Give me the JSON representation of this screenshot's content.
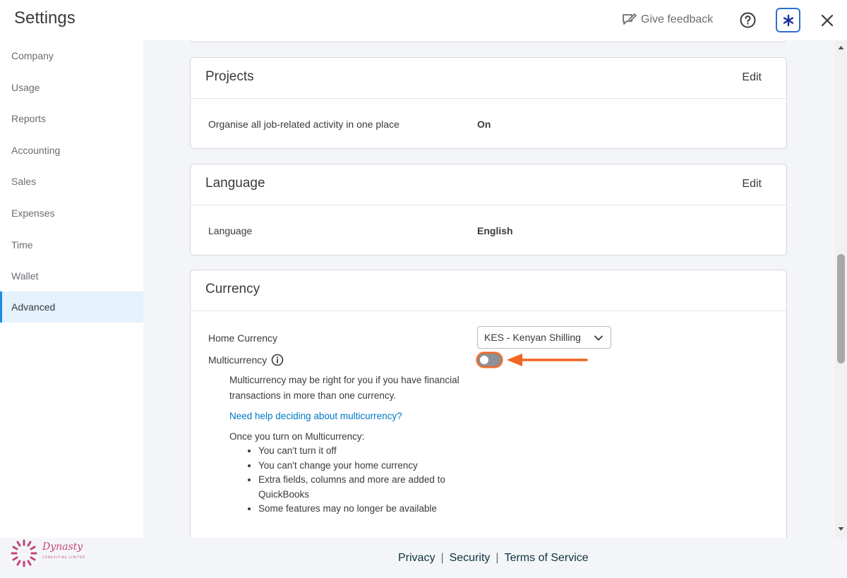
{
  "header": {
    "title": "Settings",
    "feedback_label": "Give feedback"
  },
  "sidebar": {
    "items": [
      {
        "label": "Company"
      },
      {
        "label": "Usage"
      },
      {
        "label": "Reports"
      },
      {
        "label": "Accounting"
      },
      {
        "label": "Sales"
      },
      {
        "label": "Expenses"
      },
      {
        "label": "Time"
      },
      {
        "label": "Wallet"
      },
      {
        "label": "Advanced",
        "active": true
      }
    ]
  },
  "projects": {
    "title": "Projects",
    "edit_label": "Edit",
    "row_label": "Organise all job-related activity in one place",
    "row_value": "On"
  },
  "language": {
    "title": "Language",
    "edit_label": "Edit",
    "row_label": "Language",
    "row_value": "English"
  },
  "currency": {
    "title": "Currency",
    "home_currency_label": "Home Currency",
    "home_currency_value": "KES - Kenyan Shilling",
    "multicurrency_label": "Multicurrency",
    "multicurrency_on": false,
    "desc_line1": "Multicurrency may be right for you if you have financial",
    "desc_line2": "transactions in more than one currency.",
    "help_link": "Need help deciding about multicurrency?",
    "once_on": "Once you turn on Multicurrency:",
    "bullets": [
      "You can't turn it off",
      "You can't change your home currency",
      "Extra fields, columns and more are added to QuickBooks",
      "Some features may no longer be available"
    ]
  },
  "footer": {
    "privacy": "Privacy",
    "separator": "|",
    "security": "Security",
    "terms": "Terms of Service"
  },
  "logo": {
    "name": "Dynasty",
    "subtitle": "CONSULTING LIMITED"
  },
  "colors": {
    "accent": "#1c8de0",
    "highlight": "#f26522",
    "link": "#0077c5"
  }
}
